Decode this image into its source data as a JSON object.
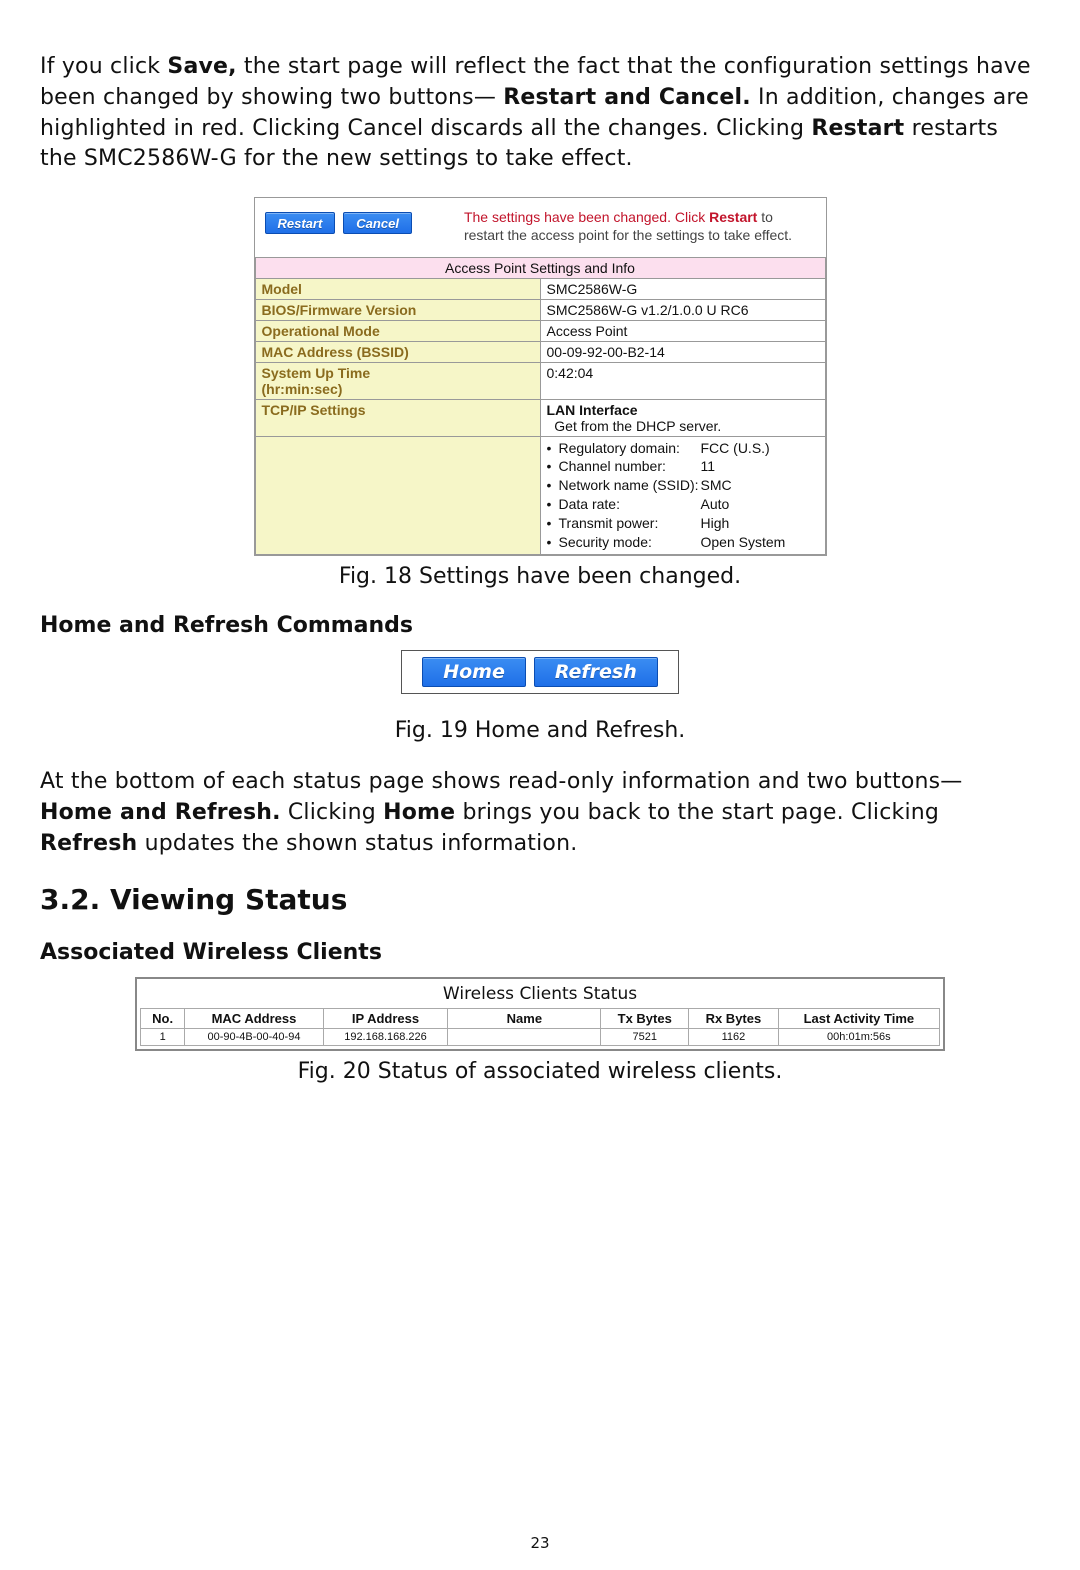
{
  "intro": {
    "p1_a": "If you click ",
    "p1_save": "Save,",
    "p1_b": " the start page will reflect the fact that the configuration settings have been changed by showing two buttons—",
    "p1_restart_cancel": "Restart and Cancel.",
    "p1_c": " In addition, changes are highlighted in red. Clicking Cancel discards all the changes. Clicking ",
    "p1_restart": "Restart",
    "p1_d": " restarts the SMC2586W-G for the new settings to take effect."
  },
  "fig18": {
    "buttons": {
      "restart": "Restart",
      "cancel": "Cancel"
    },
    "notice_a": "The settings have been changed. Click ",
    "notice_restart": "Restart",
    "notice_b": " to restart the access point for the settings to take effect.",
    "table_title": "Access Point Settings and Info",
    "rows": {
      "model_label": "Model",
      "model_value": "SMC2586W-G",
      "bios_label": "BIOS/Firmware Version",
      "bios_value": "SMC2586W-G v1.2/1.0.0 U RC6",
      "opmode_label": "Operational Mode",
      "opmode_value": "Access Point",
      "mac_label": "MAC Address (BSSID)",
      "mac_value": "00-09-92-00-B2-14",
      "uptime_label1": "System Up Time",
      "uptime_label2": "(hr:min:sec)",
      "uptime_value": "0:42:04",
      "tcpip_label": "TCP/IP Settings",
      "tcpip_line1": "LAN Interface",
      "tcpip_line2": "Get from the DHCP server."
    },
    "wlan": {
      "reg_label": "Regulatory domain:",
      "reg_value": "FCC (U.S.)",
      "ch_label": "Channel number:",
      "ch_value": "11",
      "ssid_label": "Network name (SSID):",
      "ssid_value": "SMC",
      "rate_label": "Data rate:",
      "rate_value": "Auto",
      "tx_label": "Transmit power:",
      "tx_value": "High",
      "sec_label": "Security mode:",
      "sec_value": "Open System"
    },
    "caption": "Fig. 18 Settings have been changed."
  },
  "home_refresh": {
    "heading": "Home and Refresh Commands",
    "home": "Home",
    "refresh": "Refresh",
    "caption": "Fig. 19 Home and Refresh.",
    "para_a": "At the bottom of each status page shows read-only information and two buttons—",
    "para_hr": "Home and Refresh.",
    "para_b": " Clicking ",
    "para_home": "Home",
    "para_c": " brings you back to the start page. Clicking ",
    "para_refresh": "Refresh",
    "para_d": " updates the shown status information."
  },
  "section32": {
    "title": "3.2. Viewing Status",
    "sub": "Associated Wireless Clients"
  },
  "fig20": {
    "title": "Wireless Clients Status",
    "headers": {
      "no": "No.",
      "mac": "MAC Address",
      "ip": "IP Address",
      "name": "Name",
      "tx": "Tx Bytes",
      "rx": "Rx Bytes",
      "last": "Last Activity Time"
    },
    "row": {
      "no": "1",
      "mac": "00-90-4B-00-40-94",
      "ip": "192.168.168.226",
      "name": "",
      "tx": "7521",
      "rx": "1162",
      "last": "00h:01m:56s"
    },
    "caption": "Fig. 20 Status of associated wireless clients."
  },
  "page_number": "23"
}
